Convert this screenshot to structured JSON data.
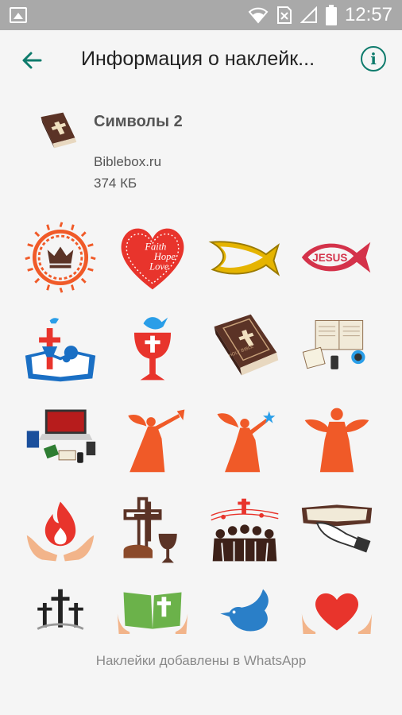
{
  "status_bar": {
    "time": "12:57"
  },
  "app_bar": {
    "title": "Информация о наклейк..."
  },
  "pack": {
    "name": "Символы 2",
    "publisher": "Biblebox.ru",
    "size": "374 КБ"
  },
  "stickers": [
    {
      "name": "crown-of-thorns"
    },
    {
      "name": "faith-hope-love-heart"
    },
    {
      "name": "ichthys-gold"
    },
    {
      "name": "jesus-fish-red"
    },
    {
      "name": "bible-cross-dove"
    },
    {
      "name": "chalice-dove"
    },
    {
      "name": "holy-bible-book"
    },
    {
      "name": "open-bible-coffee"
    },
    {
      "name": "laptop-bibles"
    },
    {
      "name": "angel-trumpet"
    },
    {
      "name": "angel-star"
    },
    {
      "name": "angel-praying"
    },
    {
      "name": "flame-hands"
    },
    {
      "name": "cross-bread-chalice"
    },
    {
      "name": "choir-notes"
    },
    {
      "name": "hands-on-bible"
    },
    {
      "name": "three-crosses"
    },
    {
      "name": "green-bible-hands"
    },
    {
      "name": "blue-dove"
    },
    {
      "name": "heart-hands"
    }
  ],
  "sticker_texts": {
    "faith": "Faith",
    "hope": "Hope",
    "love": "Love",
    "jesus": "JESUS",
    "bible": "HOLY BIBLE"
  },
  "footer": {
    "text": "Наклейки добавлены в WhatsApp"
  },
  "colors": {
    "accent": "#0e7b6c",
    "red": "#f05a28",
    "brown": "#5b3326"
  }
}
